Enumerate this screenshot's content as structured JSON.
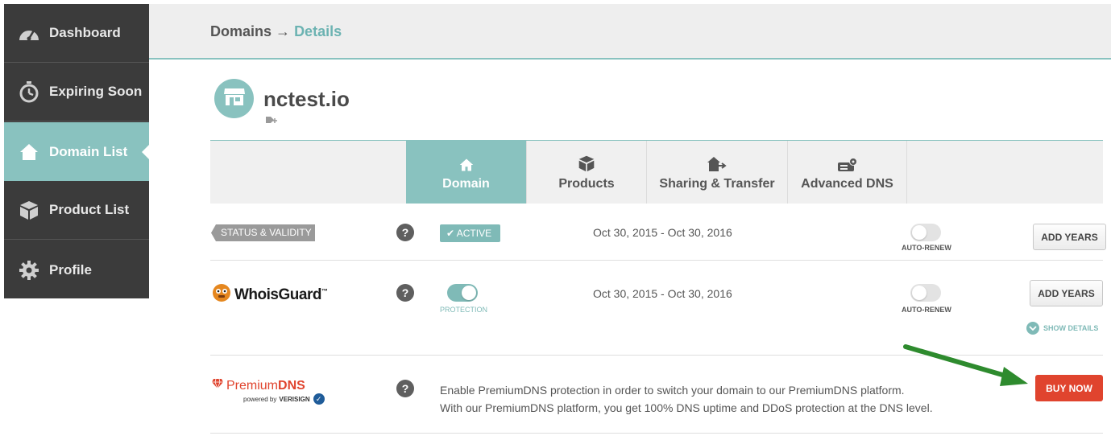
{
  "sidebar": {
    "items": [
      {
        "label": "Dashboard",
        "icon": "gauge-icon",
        "active": false
      },
      {
        "label": "Expiring Soon",
        "icon": "stopwatch-icon",
        "active": false
      },
      {
        "label": "Domain List",
        "icon": "home-icon",
        "active": true
      },
      {
        "label": "Product List",
        "icon": "box-icon",
        "active": false
      },
      {
        "label": "Profile",
        "icon": "gear-icon",
        "active": false
      }
    ]
  },
  "header": {
    "breadcrumb_root": "Domains",
    "breadcrumb_sep": "→",
    "breadcrumb_current": "Details"
  },
  "domain": {
    "name": "nctest.io",
    "avatar_icon": "storefront-icon",
    "tag_icon": "tag-add-icon"
  },
  "tabs": [
    {
      "label": "Domain",
      "icon": "home-icon",
      "active": true
    },
    {
      "label": "Products",
      "icon": "box-icon",
      "active": false
    },
    {
      "label": "Sharing & Transfer",
      "icon": "home-transfer-icon",
      "active": false
    },
    {
      "label": "Advanced DNS",
      "icon": "server-gear-icon",
      "active": false
    }
  ],
  "status_row": {
    "tag": "STATUS & VALIDITY",
    "help": "?",
    "badge": "ACTIVE",
    "dates": "Oct 30, 2015 - Oct 30, 2016",
    "autorenew_label": "AUTO-RENEW",
    "autorenew_on": false,
    "button": "ADD YEARS"
  },
  "whois_row": {
    "brand": "WhoisGuard",
    "tm": "™",
    "help": "?",
    "protection_label": "PROTECTION",
    "protection_on": true,
    "dates": "Oct 30, 2015 - Oct 30, 2016",
    "autorenew_label": "AUTO-RENEW",
    "autorenew_on": false,
    "button": "ADD YEARS",
    "show_details": "SHOW DETAILS"
  },
  "pdns_row": {
    "brand_a": "Premium",
    "brand_b": "DNS",
    "powered_by": "powered by",
    "verisign": "VERISIGN",
    "help": "?",
    "desc_line1": "Enable PremiumDNS protection in order to switch your domain to our PremiumDNS platform.",
    "desc_line2": "With our PremiumDNS platform, you get 100% DNS uptime and DDoS protection at the DNS level.",
    "button": "BUY NOW"
  },
  "colors": {
    "sidebar_bg": "#3b3b3b",
    "accent_teal": "#89c2bf",
    "buy_red": "#e0442e",
    "arrow_green": "#2e8b2e"
  }
}
